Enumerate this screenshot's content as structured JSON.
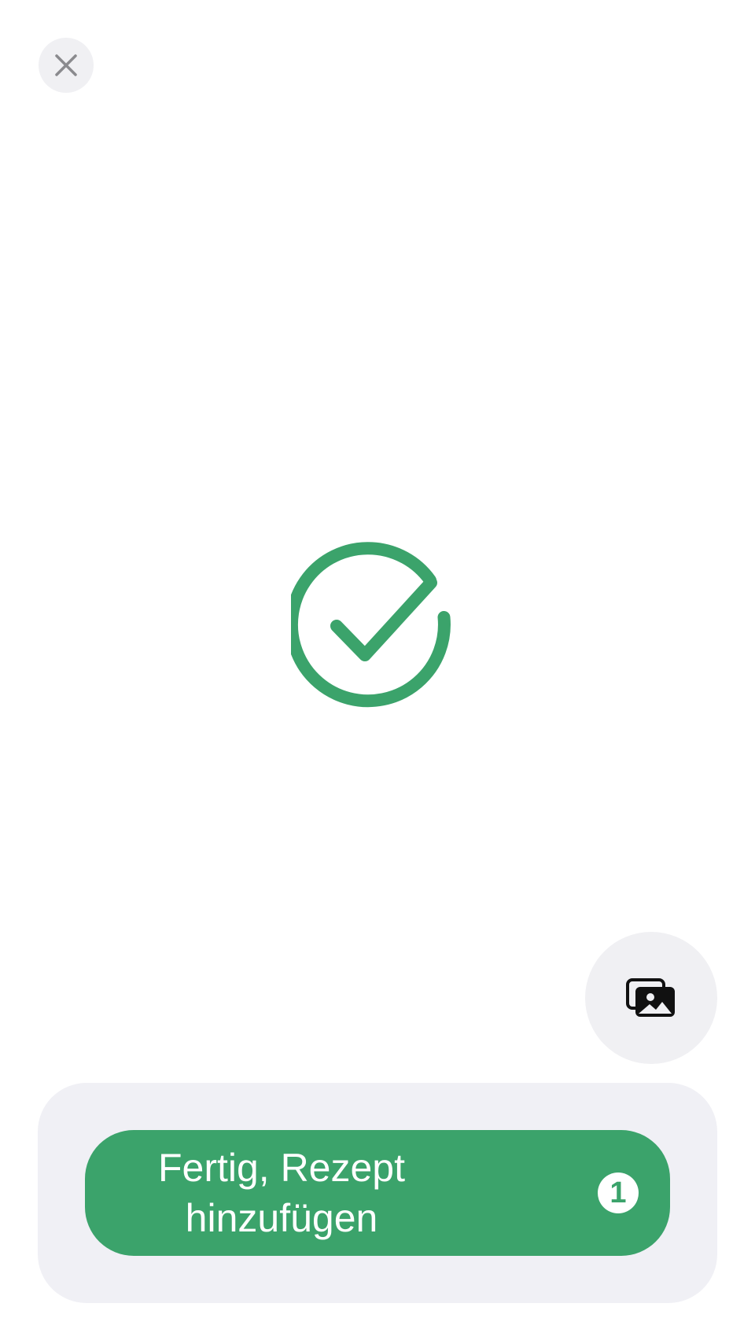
{
  "top_bar": {
    "close_icon": "close-icon"
  },
  "status": {
    "icon": "checkmark-circle-icon",
    "color": "#3ba36b"
  },
  "gallery_button": {
    "icon": "photo-library-icon"
  },
  "primary_action": {
    "label": "Fertig, Rezept hinzufügen",
    "count": "1",
    "color": "#3ba36b"
  }
}
